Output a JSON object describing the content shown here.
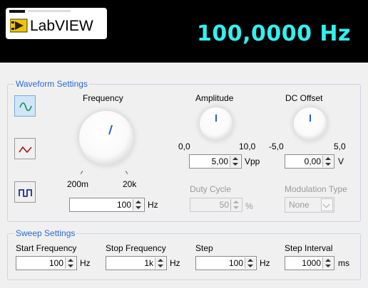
{
  "header": {
    "logo_text": "LabVIEW",
    "frequency_readout": "100,0000 Hz"
  },
  "waveform": {
    "title": "Waveform Settings",
    "buttons": [
      {
        "icon": "sine-wave-icon",
        "selected": true
      },
      {
        "icon": "triangle-wave-icon",
        "selected": false
      },
      {
        "icon": "square-wave-icon",
        "selected": false
      }
    ],
    "frequency": {
      "label": "Frequency",
      "min_label": "200m",
      "max_label": "20k",
      "value": "100",
      "unit": "Hz"
    },
    "amplitude": {
      "label": "Amplitude",
      "min_label": "0,0",
      "max_label": "10,0",
      "value": "5,00",
      "unit": "Vpp"
    },
    "dc_offset": {
      "label": "DC Offset",
      "min_label": "-5,0",
      "max_label": "5,0",
      "value": "0,00",
      "unit": "V"
    },
    "duty_cycle": {
      "label": "Duty Cycle",
      "value": "50",
      "unit": "%"
    },
    "modulation": {
      "label": "Modulation Type",
      "value": "None"
    }
  },
  "sweep": {
    "title": "Sweep Settings",
    "start": {
      "label": "Start Frequency",
      "value": "100",
      "unit": "Hz"
    },
    "stop": {
      "label": "Stop Frequency",
      "value": "1k",
      "unit": "Hz"
    },
    "step": {
      "label": "Step",
      "value": "100",
      "unit": "Hz"
    },
    "interval": {
      "label": "Step Interval",
      "value": "1000",
      "unit": "ms"
    }
  },
  "colors": {
    "readout": "#34f0f0",
    "group_title": "#2a6ad3",
    "sine": "#1b8a3a",
    "triangle": "#9a1b1b",
    "square": "#1b2f9a",
    "knob_pointer": "#2a5fd0"
  }
}
